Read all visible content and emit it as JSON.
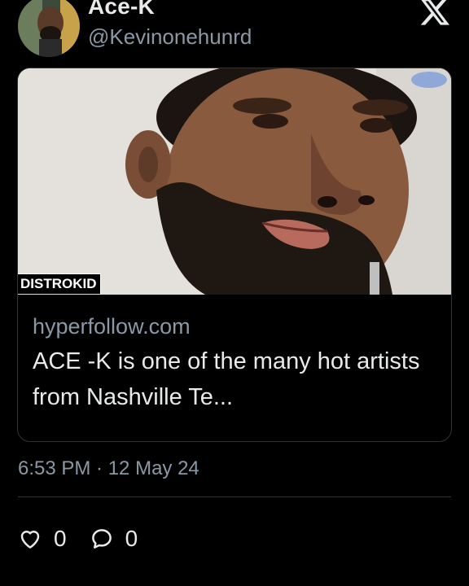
{
  "header": {
    "display_name": "Ace-K",
    "handle": "@Kevinonehunrd"
  },
  "card": {
    "brand_label": "DISTROKID",
    "domain": "hyperfollow.com",
    "title": "ACE -K is one of the many hot artists from Nashville Te..."
  },
  "tweet": {
    "timestamp": "6:53 PM · 12 May 24"
  },
  "actions": {
    "like_count": "0",
    "reply_count": "0"
  },
  "colors": {
    "background": "#000000",
    "text": "#e7e9ea",
    "secondary_text": "#8b98a5",
    "border": "#2f3336"
  },
  "icons": [
    "x-logo-icon",
    "heart-icon",
    "reply-icon"
  ]
}
